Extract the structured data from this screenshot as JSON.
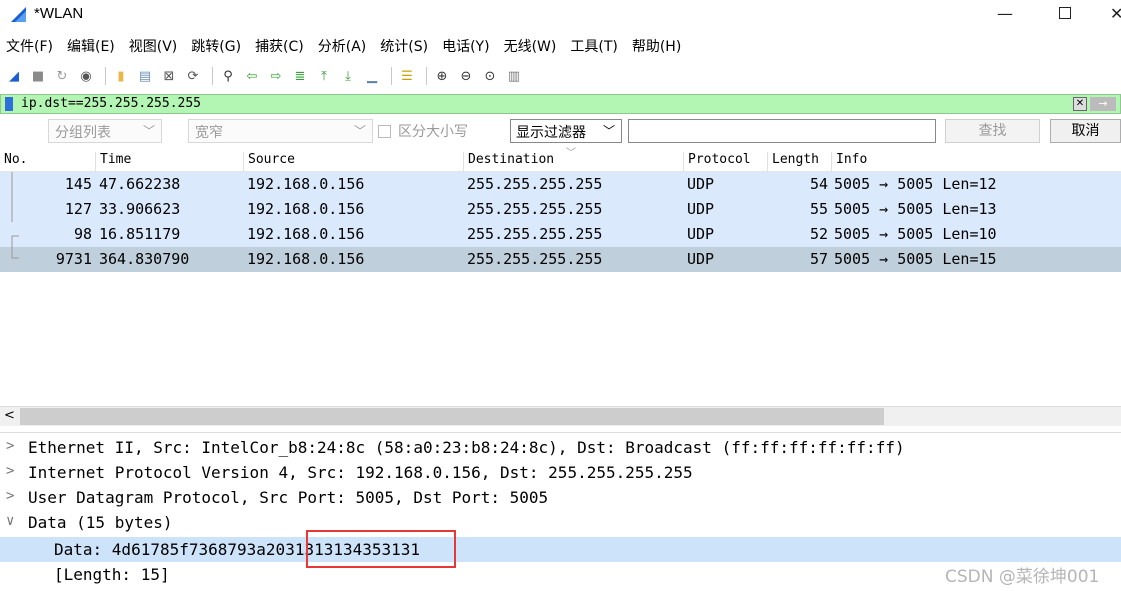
{
  "window": {
    "title": "*WLAN",
    "minimize": "—"
  },
  "menu": [
    "文件(F)",
    "编辑(E)",
    "视图(V)",
    "跳转(G)",
    "捕获(C)",
    "分析(A)",
    "统计(S)",
    "电话(Y)",
    "无线(W)",
    "工具(T)",
    "帮助(H)"
  ],
  "toolbar": {
    "icons": [
      {
        "name": "shark-fin-start-icon",
        "glyph": "◢",
        "color": "#1a5fd0"
      },
      {
        "name": "stop-capture-icon",
        "glyph": "■",
        "color": "#8a8a8a"
      },
      {
        "name": "restart-capture-icon",
        "glyph": "↻",
        "color": "#9a9a9a"
      },
      {
        "name": "capture-options-icon",
        "glyph": "◉",
        "color": "#555"
      },
      {
        "name": "open-file-icon",
        "glyph": "▮",
        "color": "#e7b84b"
      },
      {
        "name": "save-file-icon",
        "glyph": "▤",
        "color": "#6a8fb8"
      },
      {
        "name": "close-file-icon",
        "glyph": "⊠",
        "color": "#555"
      },
      {
        "name": "reload-file-icon",
        "glyph": "⟳",
        "color": "#555"
      },
      {
        "name": "find-packet-icon",
        "glyph": "⚲",
        "color": "#333"
      },
      {
        "name": "go-back-icon",
        "glyph": "⇦",
        "color": "#3a9f3a"
      },
      {
        "name": "go-forward-icon",
        "glyph": "⇨",
        "color": "#3a9f3a"
      },
      {
        "name": "go-to-packet-icon",
        "glyph": "≣",
        "color": "#3a9f3a"
      },
      {
        "name": "first-packet-icon",
        "glyph": "⤒",
        "color": "#3a9f3a"
      },
      {
        "name": "last-packet-icon",
        "glyph": "⤓",
        "color": "#3a9f3a"
      },
      {
        "name": "autoscroll-icon",
        "glyph": "▁",
        "color": "#5a7fb0"
      },
      {
        "name": "colorize-icon",
        "glyph": "☰",
        "color": "#c8a000"
      },
      {
        "name": "zoom-in-icon",
        "glyph": "⊕",
        "color": "#333"
      },
      {
        "name": "zoom-out-icon",
        "glyph": "⊖",
        "color": "#333"
      },
      {
        "name": "zoom-normal-icon",
        "glyph": "⊙",
        "color": "#333"
      },
      {
        "name": "resize-columns-icon",
        "glyph": "▥",
        "color": "#7a7a7a"
      }
    ]
  },
  "filter": {
    "value": "ip.dst==255.255.255.255",
    "clear": "✕",
    "apply": "→"
  },
  "findbar": {
    "packet_list_select": "分组列表",
    "width_select": "宽窄",
    "case_label": "区分大小写",
    "display_filter_select": "显示过滤器",
    "find_button": "查找",
    "cancel_button": "取消"
  },
  "columns": {
    "no": "No.",
    "time": "Time",
    "source": "Source",
    "destination": "Destination",
    "protocol": "Protocol",
    "length": "Length",
    "info": "Info"
  },
  "packets": [
    {
      "no": "145",
      "time": "47.662238",
      "source": "192.168.0.156",
      "destination": "255.255.255.255",
      "protocol": "UDP",
      "length": "54",
      "info": "5005 → 5005 Len=12"
    },
    {
      "no": "127",
      "time": "33.906623",
      "source": "192.168.0.156",
      "destination": "255.255.255.255",
      "protocol": "UDP",
      "length": "55",
      "info": "5005 → 5005 Len=13"
    },
    {
      "no": "98",
      "time": "16.851179",
      "source": "192.168.0.156",
      "destination": "255.255.255.255",
      "protocol": "UDP",
      "length": "52",
      "info": "5005 → 5005 Len=10"
    },
    {
      "no": "9731",
      "time": "364.830790",
      "source": "192.168.0.156",
      "destination": "255.255.255.255",
      "protocol": "UDP",
      "length": "57",
      "info": "5005 → 5005 Len=15"
    }
  ],
  "details": {
    "ethernet": "Ethernet II, Src: IntelCor_b8:24:8c (58:a0:23:b8:24:8c), Dst: Broadcast (ff:ff:ff:ff:ff:ff)",
    "ip": "Internet Protocol Version 4, Src: 192.168.0.156, Dst: 255.255.255.255",
    "udp": "User Datagram Protocol, Src Port: 5005, Dst Port: 5005",
    "data": "Data (15 bytes)",
    "data_value": "Data: 4d61785f7368793a2031313134353131",
    "length": "[Length: 15]"
  },
  "watermark": "CSDN @菜徐坤001"
}
